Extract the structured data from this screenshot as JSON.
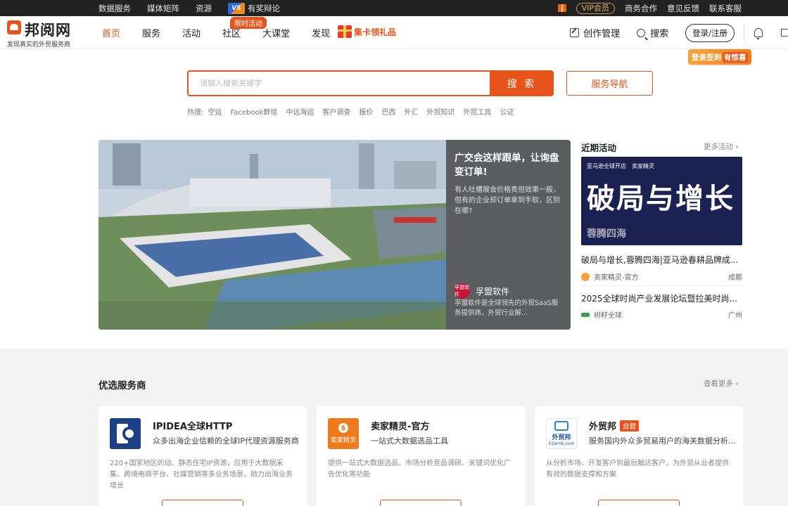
{
  "topbar": {
    "left_links": [
      "数据服务",
      "媒体矩阵",
      "资源"
    ],
    "vs_logo": "VS",
    "debate": "有奖辩论",
    "vip": "VIP会员",
    "right_links": [
      "商务合作",
      "意见反馈",
      "联系客服"
    ]
  },
  "header": {
    "logo_text": "邦阅网",
    "logo_sub": "发现真实的外贸服务商",
    "nav": [
      "首页",
      "服务",
      "活动",
      "社区",
      "大课堂",
      "发现"
    ],
    "hot_badge": "限时活动",
    "card_gift": "集卡领礼品",
    "create": "创作管理",
    "search": "搜索",
    "login": "登录/注册",
    "signin_prefix": "登录签到",
    "signin_highlight": "有惊喜"
  },
  "search": {
    "placeholder": "请输入搜索关键字",
    "button": "搜 索",
    "service_nav": "服务导航",
    "hot_label": "热搜:",
    "hot_terms": [
      "空运",
      "Facebook群组",
      "中远海运",
      "客户调查",
      "报价",
      "巴西",
      "外汇",
      "外贸知识",
      "外贸工具",
      "公证"
    ]
  },
  "banner": {
    "title": "广交会这样跟单，让询盘变订单!",
    "desc": "有人吐槽展会价格贵但效果一般，但有的企业却订单拿到手软，区别在哪?",
    "brand_logo": "孚盟软件",
    "brand": "孚盟软件",
    "brand_desc": "孚盟软件是全球领先的外贸SaaS服务提供商，外贸行业解..."
  },
  "recent": {
    "title": "近期活动",
    "more": "更多活动",
    "image_tags": [
      "亚马逊全球开店",
      "卖家精灵"
    ],
    "image_big": "破局与增长",
    "image_sub": "蓉腾四海",
    "items": [
      {
        "title": "破局与增长,蓉腾四海|亚马逊春耕品牌成...",
        "org": "卖家精灵-官方",
        "city": "成都"
      },
      {
        "title": "2025全球时尚产业发展论坛暨拉美时尚...",
        "org": "树籽全球",
        "city": "广州"
      }
    ]
  },
  "providers": {
    "title": "优选服务商",
    "more": "查看更多",
    "cards": [
      {
        "name": "IPIDEA全球HTTP",
        "sub": "众多出海企业信赖的全球IP代理资源服务商",
        "desc": "220+国家地区的动、静态住宅IP资源，应用于大数据采集、跨境电商平台、社媒营销等多业务场景，助力出海业务增长",
        "logo": ""
      },
      {
        "name": "卖家精灵-官方",
        "sub": "一站式大数据选品工具",
        "desc": "提供一站式大数据选品、市场分析竞品调研、关键词优化广告优化等功能",
        "logo": "卖家精灵"
      },
      {
        "name": "外贸邦",
        "tag": "自营",
        "sub": "服务国内外众多贸易用户的海关数据分析...",
        "desc": "从分析市场、开发客户到最后触达客户，为外贸从业者提供有效的数据支撑和方案",
        "logo": "外贸邦",
        "logo_url": "52wmb.com"
      }
    ]
  },
  "colors": {
    "accent": "#e8531c",
    "topbar": "#222222"
  }
}
